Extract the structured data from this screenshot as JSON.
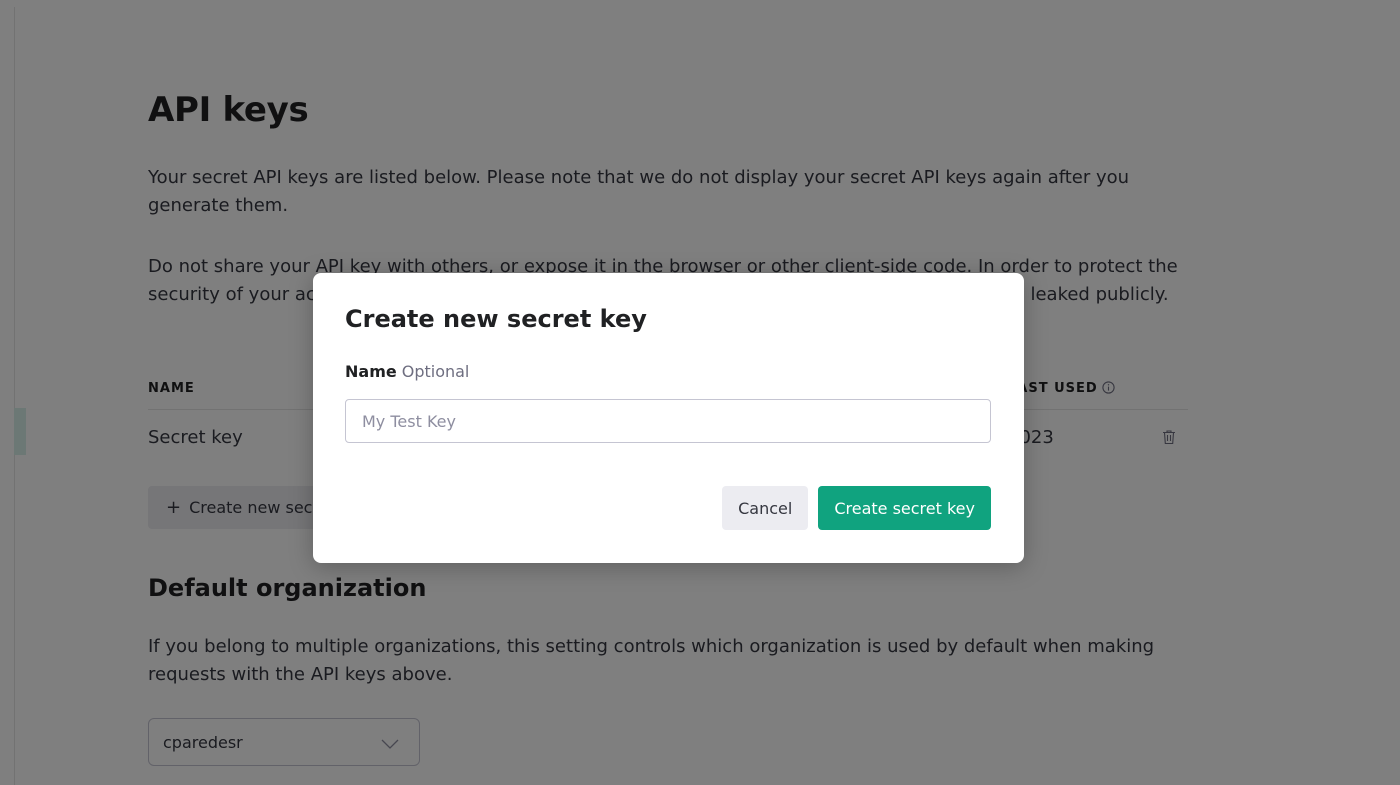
{
  "page": {
    "title": "API keys",
    "intro": "Your secret API keys are listed below. Please note that we do not display your secret API keys again after you generate them.",
    "warning": "Do not share your API key with others, or expose it in the browser or other client-side code. In order to protect the security of your account, OpenAI may also automatically rotate any API key that we've found has leaked publicly.",
    "table": {
      "col_name": "NAME",
      "col_last_used": "LAST USED",
      "rows": [
        {
          "name": "Secret key",
          "last_used": "2023"
        }
      ]
    },
    "create_button_label": "Create new secret key",
    "default_org": {
      "heading": "Default organization",
      "description": "If you belong to multiple organizations, this setting controls which organization is used by default when making requests with the API keys above.",
      "selected": "cparedesr"
    }
  },
  "modal": {
    "title": "Create new secret key",
    "field_label": "Name",
    "field_optional": "Optional",
    "input_placeholder": "My Test Key",
    "input_value": "",
    "cancel_label": "Cancel",
    "confirm_label": "Create secret key"
  },
  "colors": {
    "accent": "#10a37f",
    "overlay": "rgba(0,0,0,0.5)",
    "secondary_button": "#ececf1"
  },
  "icons": {
    "info": "info-icon",
    "trash": "trash-icon",
    "plus": "plus-icon",
    "chevron": "chevron-down-icon"
  }
}
